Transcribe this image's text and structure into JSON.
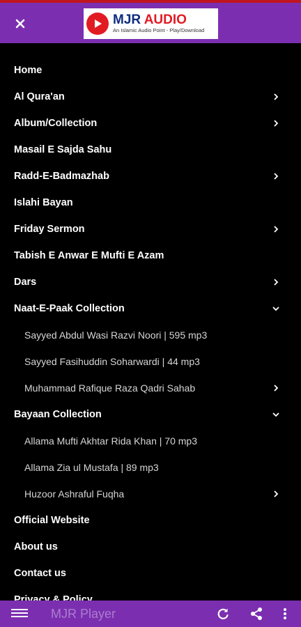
{
  "header": {
    "close_icon": "close-icon",
    "logo": {
      "title_part1": "MJR ",
      "title_part2": "AUDIO",
      "tagline": "An Islamic Audio Point - Play/Download"
    }
  },
  "menu": {
    "items": [
      {
        "label": "Home",
        "sub": false,
        "chevron": "none"
      },
      {
        "label": "Al Qura'an",
        "sub": false,
        "chevron": "right"
      },
      {
        "label": "Album/Collection",
        "sub": false,
        "chevron": "right"
      },
      {
        "label": "Masail E Sajda Sahu",
        "sub": false,
        "chevron": "none"
      },
      {
        "label": "Radd-E-Badmazhab",
        "sub": false,
        "chevron": "right"
      },
      {
        "label": "Islahi Bayan",
        "sub": false,
        "chevron": "none"
      },
      {
        "label": "Friday Sermon",
        "sub": false,
        "chevron": "right"
      },
      {
        "label": "Tabish E Anwar E Mufti E Azam",
        "sub": false,
        "chevron": "none"
      },
      {
        "label": "Dars",
        "sub": false,
        "chevron": "right"
      },
      {
        "label": "Naat-E-Paak Collection",
        "sub": false,
        "chevron": "down"
      },
      {
        "label": "Sayyed Abdul Wasi Razvi Noori | 595 mp3",
        "sub": true,
        "chevron": "none"
      },
      {
        "label": "Sayyed Fasihuddin Soharwardi | 44 mp3",
        "sub": true,
        "chevron": "none"
      },
      {
        "label": "Muhammad Rafique Raza Qadri Sahab",
        "sub": true,
        "chevron": "right"
      },
      {
        "label": "Bayaan Collection",
        "sub": false,
        "chevron": "down"
      },
      {
        "label": "Allama Mufti Akhtar Rida Khan | 70 mp3",
        "sub": true,
        "chevron": "none"
      },
      {
        "label": "Allama Zia ul Mustafa | 89 mp3",
        "sub": true,
        "chevron": "none"
      },
      {
        "label": "Huzoor Ashraful Fuqha",
        "sub": true,
        "chevron": "right"
      },
      {
        "label": "Official Website",
        "sub": false,
        "chevron": "none"
      },
      {
        "label": "About us",
        "sub": false,
        "chevron": "none"
      },
      {
        "label": "Contact us",
        "sub": false,
        "chevron": "none"
      },
      {
        "label": "Privacy & Policy",
        "sub": false,
        "chevron": "none"
      }
    ]
  },
  "bottom_bar": {
    "menu_icon": "hamburger-menu-icon",
    "title": "MJR Player",
    "refresh_icon": "refresh-icon",
    "share_icon": "share-icon",
    "more_icon": "more-vertical-icon"
  },
  "colors": {
    "accent": "#7b2fb0",
    "background": "#000000",
    "brand_red": "#e21b23",
    "brand_blue": "#0f2c80"
  }
}
